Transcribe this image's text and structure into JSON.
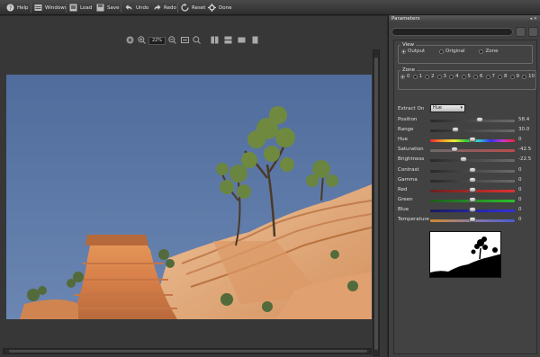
{
  "toolbar": {
    "help": "Help",
    "windows": "Windows",
    "load": "Load",
    "save": "Save",
    "undo": "Undo",
    "redo": "Redo",
    "reset": "Reset",
    "done": "Done"
  },
  "viewer": {
    "zoom": "22%"
  },
  "panel": {
    "title": "Parameters",
    "view": {
      "legend": "View",
      "options": [
        "Output",
        "Original",
        "Zone"
      ],
      "selected": "Output"
    },
    "zone": {
      "legend": "Zone",
      "options": [
        "0",
        "1",
        "2",
        "3",
        "4",
        "5",
        "6",
        "7",
        "8",
        "9",
        "10"
      ],
      "selected": "0"
    },
    "extract_on": {
      "label": "Extract On",
      "value": "Hue"
    },
    "sliders": [
      {
        "label": "Position",
        "value": "58.4",
        "level": 0.58
      },
      {
        "label": "Range",
        "value": "30.0",
        "level": 0.3
      },
      {
        "label": "Hue",
        "value": "0",
        "level": 0.5
      },
      {
        "label": "Saturation",
        "value": "-42.5",
        "level": 0.29
      },
      {
        "label": "Brightness",
        "value": "-22.5",
        "level": 0.39
      },
      {
        "label": "Contrast",
        "value": "0",
        "level": 0.5
      },
      {
        "label": "Gamma",
        "value": "0",
        "level": 0.5
      },
      {
        "label": "Red",
        "value": "0",
        "level": 0.5
      },
      {
        "label": "Green",
        "value": "0",
        "level": 0.5
      },
      {
        "label": "Blue",
        "value": "0",
        "level": 0.5
      },
      {
        "label": "Temperature",
        "value": "0",
        "level": 0.5
      }
    ]
  }
}
